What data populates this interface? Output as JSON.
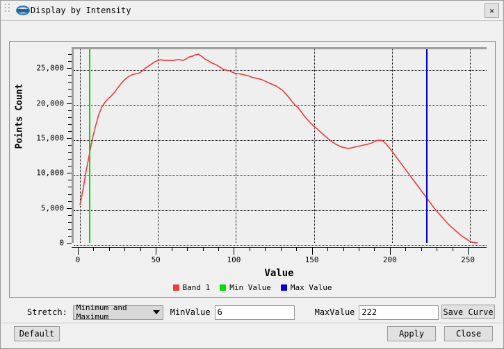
{
  "window": {
    "title": "Display by Intensity",
    "logo_icon": "lidar-logo-icon",
    "close_icon": "✕"
  },
  "chart_data": {
    "type": "line",
    "title": "",
    "xlabel": "Value",
    "ylabel": "Points Count",
    "xlim": [
      -4,
      262
    ],
    "ylim": [
      0,
      28000
    ],
    "xticks": [
      0,
      50,
      100,
      150,
      200,
      250
    ],
    "xticklabels": [
      "0",
      "50",
      "100",
      "150",
      "200",
      "250"
    ],
    "yticks": [
      0,
      5000,
      10000,
      15000,
      20000,
      25000
    ],
    "yticklabels": [
      "0",
      "5,000",
      "10,000",
      "15,000",
      "20,000",
      "25,000"
    ],
    "grid": true,
    "legend_position": "bottom",
    "series": [
      {
        "name": "Band 1",
        "color": "#ee3b3b",
        "x": [
          0,
          2,
          4,
          6,
          8,
          10,
          12,
          14,
          16,
          18,
          20,
          22,
          24,
          26,
          28,
          30,
          32,
          34,
          36,
          38,
          40,
          42,
          44,
          46,
          48,
          50,
          52,
          54,
          56,
          58,
          60,
          62,
          64,
          66,
          68,
          70,
          72,
          74,
          76,
          78,
          80,
          82,
          84,
          86,
          88,
          90,
          92,
          94,
          96,
          98,
          100,
          102,
          104,
          106,
          108,
          110,
          112,
          114,
          116,
          118,
          120,
          122,
          124,
          126,
          128,
          130,
          132,
          134,
          136,
          138,
          140,
          142,
          144,
          146,
          148,
          150,
          152,
          154,
          156,
          158,
          160,
          162,
          164,
          166,
          168,
          170,
          172,
          174,
          176,
          178,
          180,
          182,
          184,
          186,
          188,
          190,
          192,
          194,
          196,
          198,
          200,
          202,
          204,
          206,
          208,
          210,
          212,
          214,
          216,
          218,
          220,
          222,
          224,
          226,
          228,
          230,
          232,
          234,
          236,
          238,
          240,
          242,
          244,
          246,
          248,
          250,
          252,
          254,
          255
        ],
        "values": [
          5700,
          7900,
          10600,
          12900,
          15200,
          17000,
          18600,
          19700,
          20400,
          20900,
          21300,
          21800,
          22400,
          23000,
          23500,
          23900,
          24200,
          24400,
          24500,
          24600,
          24900,
          25300,
          25600,
          25900,
          26200,
          26400,
          26500,
          26400,
          26400,
          26400,
          26400,
          26500,
          26500,
          26400,
          26600,
          26900,
          27000,
          27200,
          27300,
          27000,
          26600,
          26400,
          26100,
          25900,
          25700,
          25400,
          25100,
          25000,
          24900,
          24700,
          24500,
          24500,
          24400,
          24300,
          24200,
          24000,
          23900,
          23800,
          23700,
          23500,
          23300,
          23100,
          22900,
          22700,
          22400,
          22100,
          21600,
          21100,
          20500,
          20000,
          19600,
          19000,
          18400,
          17900,
          17400,
          17000,
          16600,
          16200,
          15800,
          15400,
          15000,
          14700,
          14400,
          14200,
          14000,
          13900,
          13800,
          13900,
          14000,
          14100,
          14200,
          14300,
          14400,
          14500,
          14700,
          14900,
          15000,
          14900,
          14500,
          14000,
          13400,
          12800,
          12200,
          11600,
          11000,
          10400,
          9800,
          9200,
          8600,
          8000,
          7400,
          6800,
          6200,
          5600,
          5000,
          4500,
          4000,
          3500,
          3000,
          2600,
          2200,
          1800,
          1400,
          1100,
          800,
          500,
          350,
          300,
          300
        ]
      }
    ],
    "markers": [
      {
        "name": "Min Value",
        "color": "#00dd00",
        "x": 6
      },
      {
        "name": "Max Value",
        "color": "#0000dd",
        "x": 222
      }
    ],
    "legend": [
      {
        "label": "Band 1",
        "color": "#ee3b3b"
      },
      {
        "label": "Min Value",
        "color": "#00dd00"
      },
      {
        "label": "Max Value",
        "color": "#0000dd"
      }
    ]
  },
  "controls": {
    "stretch_label": "Stretch:",
    "stretch_value": "Minimum and Maximum",
    "stretch_options": [
      "Minimum and Maximum"
    ],
    "minvalue_label": "MinValue",
    "minvalue": "6",
    "maxvalue_label": "MaxValue",
    "maxvalue": "222",
    "save_curve_label": "Save Curve"
  },
  "footer": {
    "default_label": "Default",
    "apply_label": "Apply",
    "close_label": "Close"
  }
}
